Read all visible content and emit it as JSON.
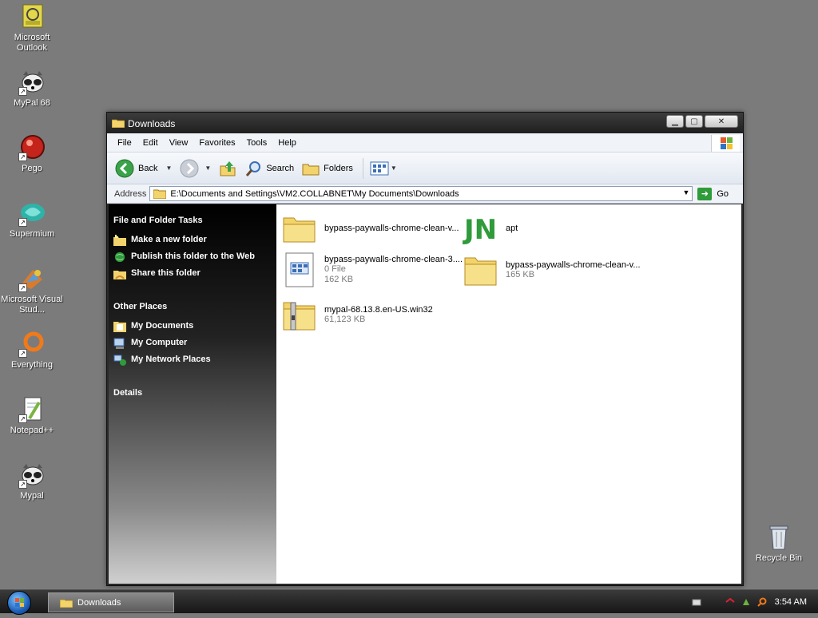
{
  "desktop": {
    "icons": [
      {
        "label": "Microsoft Outlook"
      },
      {
        "label": "MyPal 68"
      },
      {
        "label": "Pego"
      },
      {
        "label": "Supermium"
      },
      {
        "label": "Microsoft Visual Stud..."
      },
      {
        "label": "Everything"
      },
      {
        "label": "Notepad++"
      },
      {
        "label": "Mypal"
      },
      {
        "label": "Recycle Bin"
      }
    ]
  },
  "window": {
    "title": "Downloads",
    "menu": [
      "File",
      "Edit",
      "View",
      "Favorites",
      "Tools",
      "Help"
    ],
    "toolbar": {
      "back": "Back",
      "search": "Search",
      "folders": "Folders"
    },
    "address": {
      "label": "Address",
      "value": "E:\\Documents and Settings\\VM2.COLLABNET\\My Documents\\Downloads",
      "go": "Go"
    },
    "tasks": {
      "file_folder_heading": "File and Folder Tasks",
      "file_folder_items": [
        "Make a new folder",
        "Publish this folder to the Web",
        "Share this folder"
      ],
      "other_places_heading": "Other Places",
      "other_places_items": [
        "My Documents",
        "My Computer",
        "My Network Places"
      ],
      "details_heading": "Details"
    },
    "files": [
      {
        "name": "bypass-paywalls-chrome-clean-v...",
        "line2": "",
        "line3": "",
        "icon": "folder-icon"
      },
      {
        "name": "apt",
        "line2": "",
        "line3": "",
        "icon": "app-icon"
      },
      {
        "name": "bypass-paywalls-chrome-clean-3....",
        "line2": "0 File",
        "line3": "162 KB",
        "icon": "file-icon"
      },
      {
        "name": "bypass-paywalls-chrome-clean-v...",
        "line2": "165 KB",
        "line3": "",
        "icon": "zip-folder-icon"
      },
      {
        "name": "mypal-68.13.8.en-US.win32",
        "line2": "61,123 KB",
        "line3": "",
        "icon": "zip-folder-icon"
      }
    ]
  },
  "taskbar": {
    "task_label": "Downloads",
    "clock": "3:54 AM"
  },
  "colors": {
    "desktop_bg": "#7b7b7b",
    "folder_yellow": "#f3d36b",
    "link_green": "#2f9b3a"
  }
}
